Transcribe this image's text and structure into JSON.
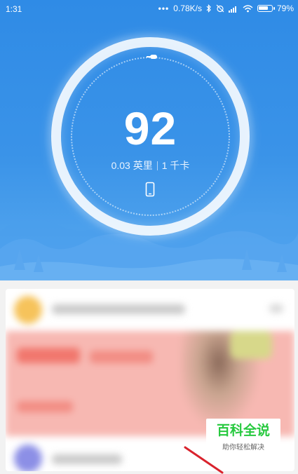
{
  "status_bar": {
    "time": "1:31",
    "network_speed": "0.78K/s",
    "battery_percent": "79%",
    "battery_level": 0.79,
    "icons": [
      "bluetooth-icon",
      "alarm-off-icon",
      "signal-icon",
      "wifi-icon",
      "battery-icon"
    ]
  },
  "ring": {
    "steps": "92",
    "distance": "0.03 英里",
    "calories": "1 千卡",
    "device_icon": "phone-icon"
  },
  "watermark": {
    "title": "百科全说",
    "subtitle": "助你轻松解决"
  },
  "colors": {
    "header_blue": "#2f8be6",
    "watermark_green": "#27c93f",
    "pointer_red": "#d9232d"
  }
}
